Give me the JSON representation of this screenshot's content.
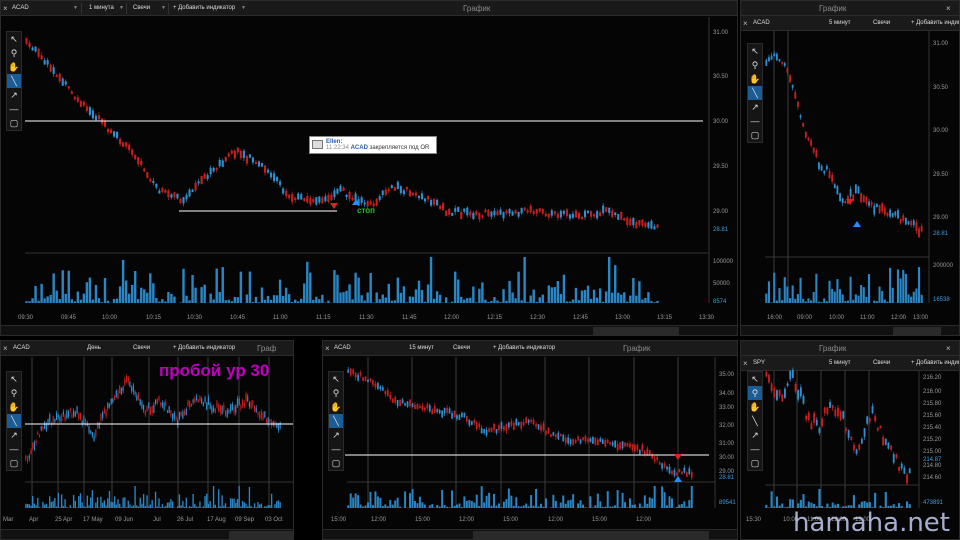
{
  "panels": {
    "main": {
      "symbol": "ACAD",
      "interval": "1 минута",
      "type": "Свечи",
      "add_indicator": "+ Добавить индикатор",
      "title": "График",
      "price_ticks": [
        "31.00",
        "30.50",
        "30.00",
        "29.50",
        "29.00",
        "28.81"
      ],
      "volume_ticks": [
        "100000",
        "50000",
        "8574"
      ],
      "time_ticks": [
        "09:30",
        "09:45",
        "10:00",
        "10:15",
        "10:30",
        "10:45",
        "11:00",
        "11:15",
        "11:30",
        "11:45",
        "12:00",
        "12:15",
        "12:30",
        "12:45",
        "13:00",
        "13:15",
        "13:30"
      ],
      "note_author": "Ellen:",
      "note_time": "11:22:34",
      "note_symbol": "ACAD",
      "note_text": "закрепляется под OR",
      "stop_label": "стоп"
    },
    "right_top": {
      "symbol": "ACAD",
      "interval": "5 минут",
      "type": "Свечи",
      "add_indicator": "+ Добавить индикатор",
      "title": "График",
      "price_ticks": [
        "31.00",
        "30.50",
        "30.00",
        "29.50",
        "29.00",
        "28.81"
      ],
      "volume_ticks": [
        "200000",
        "16538"
      ],
      "time_ticks": [
        "16:00",
        "09:00",
        "10:00",
        "11:00",
        "12:00",
        "13:00"
      ]
    },
    "bottom_left": {
      "symbol": "ACAD",
      "interval": "День",
      "type": "Свечи",
      "add_indicator": "+ Добавить индикатор",
      "title": "Граф",
      "price_ticks": [
        "40.00",
        "30.00",
        "28.81",
        "20.00"
      ],
      "volume_ticks": [
        "3302561"
      ],
      "time_ticks": [
        "Mar",
        "Apr",
        "25 Apr",
        "17 May",
        "09 Jun",
        "Jul",
        "26 Jul",
        "17 Aug",
        "09 Sep",
        "03 Oct"
      ],
      "annotation": "пробой ур 30"
    },
    "bottom_mid": {
      "symbol": "ACAD",
      "interval": "15 минут",
      "type": "Свечи",
      "add_indicator": "+ Добавить индикатор",
      "title": "График",
      "price_ticks": [
        "35.00",
        "34.00",
        "33.00",
        "32.00",
        "31.00",
        "30.00",
        "29.00",
        "28.81"
      ],
      "volume_ticks": [
        "89541"
      ],
      "time_ticks": [
        "15:00",
        "12:00",
        "15:00",
        "12:00",
        "15:00",
        "12:00",
        "15:00",
        "12:00"
      ]
    },
    "bottom_right": {
      "symbol": "SPY",
      "interval": "5 минут",
      "type": "Свечи",
      "add_indicator": "+ Добавить индикатор",
      "title": "График",
      "price_ticks": [
        "216.20",
        "216.00",
        "215.80",
        "215.60",
        "215.40",
        "215.20",
        "215.00",
        "214.87",
        "214.80",
        "214.60"
      ],
      "volume_ticks": [
        "473891"
      ],
      "time_ticks": [
        "15:30",
        "10:00",
        "11:00",
        "12:00",
        "13:00"
      ]
    }
  },
  "watermark": "hamaha.net",
  "colors": {
    "up": "#2f8fd0",
    "down": "#c81e1e",
    "volume": "#2a86c4",
    "line": "#ffffff"
  }
}
